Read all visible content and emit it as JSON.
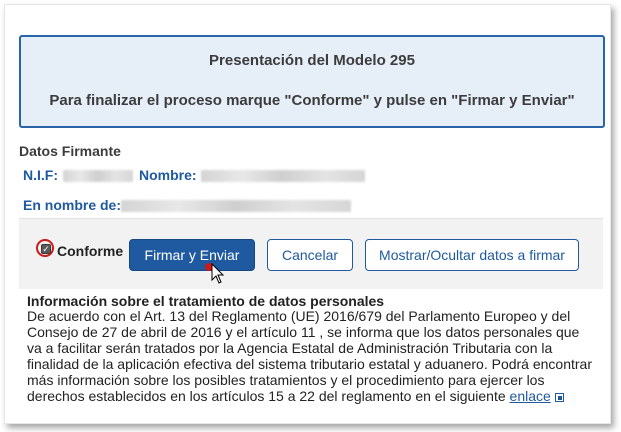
{
  "header": {
    "title": "Presentación del Modelo 295",
    "instruction": "Para finalizar el proceso marque \"Conforme\" y pulse en \"Firmar y Enviar\""
  },
  "firmante": {
    "section_title": "Datos Firmante",
    "nif_label": "N.I.F:",
    "nombre_label": "Nombre:",
    "en_nombre_label": "En nombre de:"
  },
  "actions": {
    "checkbox_label": "Conforme",
    "checkbox_checked": true,
    "firmar_label": "Firmar y Enviar",
    "cancelar_label": "Cancelar",
    "mostrar_label": "Mostrar/Ocultar datos a firmar"
  },
  "info": {
    "title": "Información sobre el tratamiento de datos personales",
    "body": "De acuerdo con el Art. 13 del Reglamento (UE) 2016/679 del Parlamento Europeo y del Consejo de 27 de abril de 2016 y el artículo 11 , se informa que los datos personales que va a facilitar serán tratados por la Agencia Estatal de Administración Tributaria con la finalidad de la aplicación efectiva del sistema tributario estatal y aduanero. Podrá encontrar más información sobre los posibles tratamientos y el procedimiento para ejercer los derechos establecidos en los artículos 15 a 22 del reglamento en el siguiente",
    "link_text": "enlace"
  },
  "colors": {
    "accent": "#1f5aa0",
    "header_bg": "#e6eef7",
    "highlight": "#d01818"
  }
}
